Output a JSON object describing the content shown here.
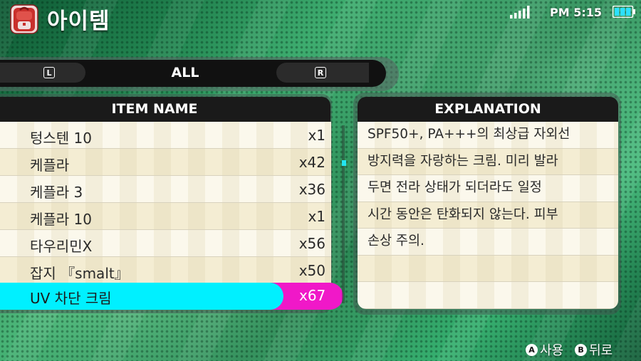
{
  "header": {
    "title": "아이템",
    "time": "PM 5:15",
    "icons": [
      "backpack-icon",
      "signal-icon",
      "battery-icon"
    ]
  },
  "category": {
    "left_key": "L",
    "label": "ALL",
    "right_key": "R"
  },
  "item_list": {
    "header": "ITEM NAME",
    "items": [
      {
        "name": "텅스텐 10",
        "qty": "x1"
      },
      {
        "name": "케플라",
        "qty": "x42"
      },
      {
        "name": "케플라 3",
        "qty": "x36"
      },
      {
        "name": "케플라 10",
        "qty": "x1"
      },
      {
        "name": "타우리민X",
        "qty": "x56"
      },
      {
        "name": "잡지 『smalt』",
        "qty": "x50"
      }
    ],
    "selected": {
      "name": "UV 차단 크림",
      "qty": "x67"
    }
  },
  "explanation": {
    "header": "EXPLANATION",
    "lines": [
      "SPF50+, PA+++의 최상급 자외선",
      "방지력을 자랑하는 크림. 미리 발라",
      "두면 전라 상태가 되더라도 일정",
      "시간 동안은 탄화되지 않는다. 피부",
      "손상 주의.",
      "",
      ""
    ]
  },
  "footer": {
    "a_key": "A",
    "a_label": "사용",
    "b_key": "B",
    "b_label": "뒤로"
  },
  "colors": {
    "selected_name_bg": "#00f0ff",
    "selected_qty_bg": "#f018c8",
    "header_bg": "#1a1a1a",
    "row_bg": "#fbf8ec"
  }
}
